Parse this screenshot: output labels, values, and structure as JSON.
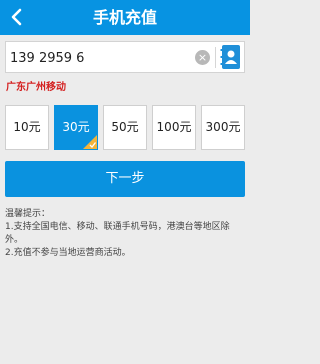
{
  "header": {
    "title": "手机充值",
    "back_icon": "chevron-left-icon"
  },
  "phone": {
    "value": "139 2959 6",
    "clear_icon": "close-circle-icon",
    "clear_glyph": "×",
    "contact_icon": "contact-book-icon"
  },
  "carrier": "广东广州移动",
  "amounts": [
    {
      "label": "10元",
      "selected": false
    },
    {
      "label": "30元",
      "selected": true
    },
    {
      "label": "50元",
      "selected": false
    },
    {
      "label": "100元",
      "selected": false
    },
    {
      "label": "300元",
      "selected": false
    }
  ],
  "next_button": "下一步",
  "tips": {
    "title": "温馨提示：",
    "lines": [
      "1.支持全国电信、移动、联通手机号码，港澳台等地区除外。",
      "2.充值不参与当地运营商活动。"
    ]
  },
  "colors": {
    "accent": "#0793e2",
    "carrier_text": "#d41f1f",
    "background": "#ececec",
    "corner_badge": "#f4b43a"
  }
}
